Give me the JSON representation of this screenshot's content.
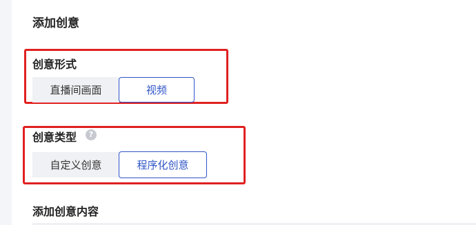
{
  "section": {
    "title": "添加创意"
  },
  "creative_form": {
    "label": "创意形式",
    "options": [
      "直播间画面",
      "视频"
    ],
    "selected": "视频"
  },
  "creative_type": {
    "label": "创意类型",
    "help_glyph": "?",
    "options": [
      "自定义创意",
      "程序化创意"
    ],
    "selected": "程序化创意"
  },
  "content": {
    "label": "添加创意内容"
  },
  "colors": {
    "accent": "#2f54c7",
    "highlight_box": "#e02020",
    "inactive_bg": "#f0f1f4"
  }
}
